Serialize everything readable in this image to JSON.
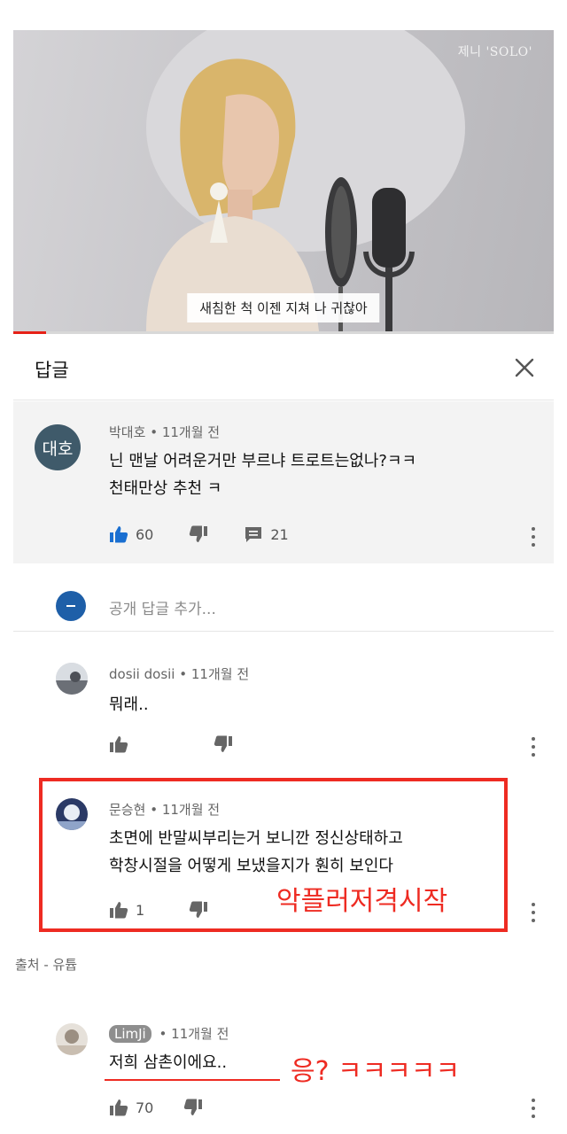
{
  "video": {
    "watermark": "제니 'SOLO'",
    "subtitle": "새침한 척 이젠 지쳐 나 귀찮아",
    "progress": 0.06
  },
  "header": {
    "title": "답글"
  },
  "parent_comment": {
    "avatar_text": "대호",
    "author": "박대호",
    "time": "11개월 전",
    "text_line1": "닌 맨날 어려운거만 부르냐 트로트는없나?ㅋㅋ",
    "text_line2": "천태만상 추천 ㅋ",
    "likes": "60",
    "replies": "21"
  },
  "add_reply": {
    "placeholder": "공개 답글 추가..."
  },
  "replies": [
    {
      "author": "dosii dosii",
      "time": "11개월 전",
      "text": "뭐래..",
      "likes": ""
    },
    {
      "author": "문승현",
      "time": "11개월 전",
      "text_line1": "초면에 반말씨부리는거 보니깐 정신상태하고",
      "text_line2": "학창시절을 어떻게 보냈을지가 훤히 보인다",
      "likes": "1"
    },
    {
      "author": "LimJi",
      "time": "11개월 전",
      "text": "저희 삼촌이에요..",
      "likes": "70"
    }
  ],
  "separator": "•",
  "annotations": {
    "box_label": "악플러저격시작",
    "reply_note": "응? ㅋㅋㅋㅋㅋ",
    "source": "출처 - 유튭"
  },
  "colors": {
    "accent_red": "#ee2b22",
    "like_blue": "#1a6fd1",
    "avatar_dark": "#3f5a6a"
  }
}
